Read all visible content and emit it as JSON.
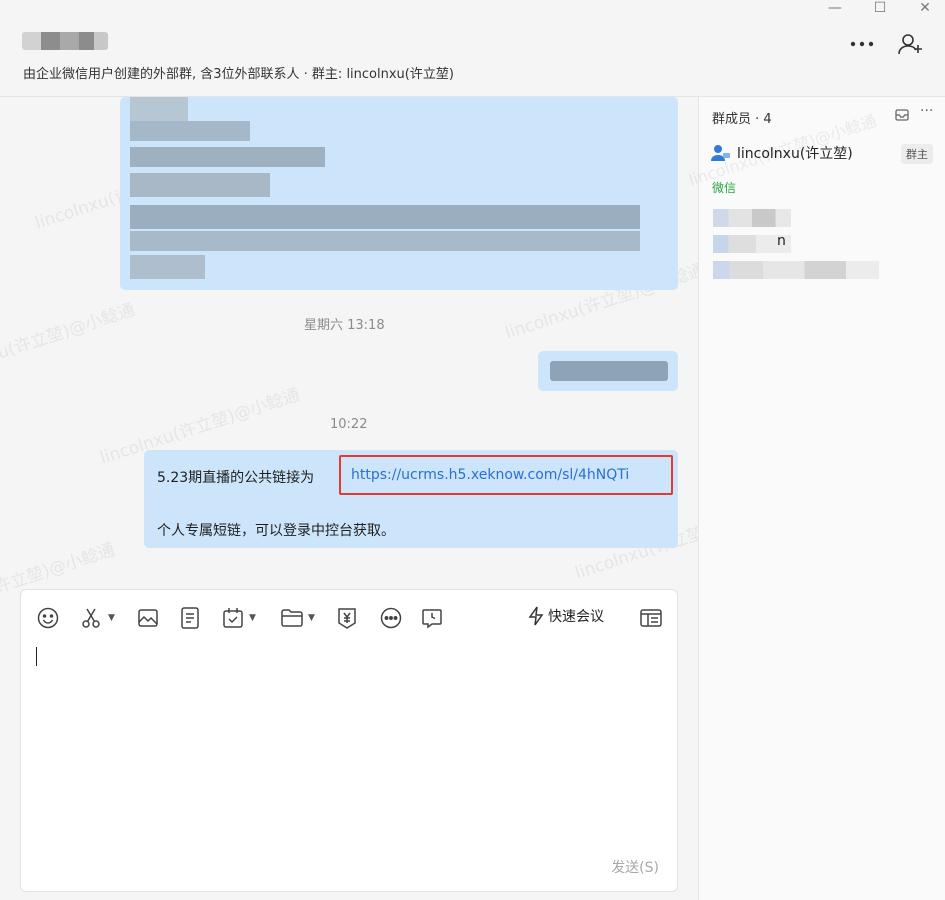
{
  "window": {
    "minimize_glyph": "—",
    "maximize_glyph": "☐",
    "close_glyph": "✕"
  },
  "header": {
    "subtitle": "由企业微信用户创建的外部群, 含3位外部联系人 · 群主: lincolnxu(许立堃)",
    "more_icon": "more-icon",
    "add_member_icon": "add-member-icon"
  },
  "watermark": {
    "text": "lincolnxu(许立堃)@小鲶通"
  },
  "messages": {
    "time_1": "星期六 13:18",
    "time_2": "10:22",
    "link_message": {
      "prefix": "5.23期直播的公共链接为",
      "link": "https://ucrms.h5.xeknow.com/sl/4hNQTi",
      "second_line": "个人专属短链，可以登录中控台获取。"
    }
  },
  "composer": {
    "tools": [
      "emoji-icon",
      "scissors-icon",
      "image-icon",
      "document-icon",
      "calendar-check-icon",
      "folder-icon",
      "red-packet-icon",
      "more-circle-icon",
      "chat-history-icon"
    ],
    "quick_meeting_label": "快速会议",
    "send_label": "发送(S)"
  },
  "side_panel": {
    "title": "群成员 · 4",
    "owner": {
      "name": "lincolnxu(许立堃)",
      "tag": "群主"
    },
    "wechat_label": "微信",
    "partial_name_fragment": "n"
  },
  "colors": {
    "bubble": "#cce5fb",
    "link": "#2a6fd6",
    "highlight_box": "#e53935",
    "wechat_green": "#2aa644"
  }
}
